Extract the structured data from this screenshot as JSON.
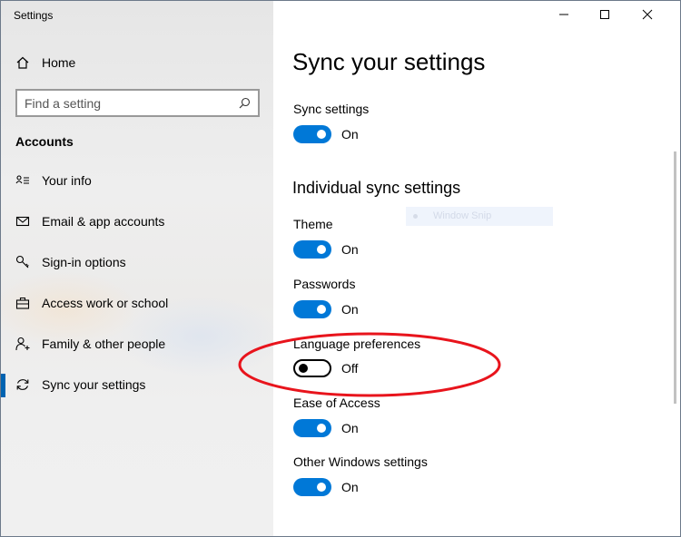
{
  "app": {
    "title": "Settings"
  },
  "sidebar": {
    "home_label": "Home",
    "search": {
      "placeholder": "Find a setting",
      "value": ""
    },
    "section_title": "Accounts",
    "items": [
      {
        "label": "Your info",
        "icon": "contact-card-icon",
        "selected": false
      },
      {
        "label": "Email & app accounts",
        "icon": "mail-icon",
        "selected": false
      },
      {
        "label": "Sign-in options",
        "icon": "key-icon",
        "selected": false
      },
      {
        "label": "Access work or school",
        "icon": "briefcase-icon",
        "selected": false
      },
      {
        "label": "Family & other people",
        "icon": "person-add-icon",
        "selected": false
      },
      {
        "label": "Sync your settings",
        "icon": "sync-icon",
        "selected": true
      }
    ]
  },
  "main": {
    "title": "Sync your settings",
    "sync_settings": {
      "label": "Sync settings",
      "state": "On"
    },
    "individual_title": "Individual sync settings",
    "settings": [
      {
        "label": "Theme",
        "state": "On"
      },
      {
        "label": "Passwords",
        "state": "On"
      },
      {
        "label": "Language preferences",
        "state": "Off"
      },
      {
        "label": "Ease of Access",
        "state": "On"
      },
      {
        "label": "Other Windows settings",
        "state": "On"
      }
    ]
  },
  "overlay": {
    "snip_text": "Window Snip"
  },
  "colors": {
    "accent": "#0078d7",
    "annotation": "#e8141c",
    "selection": "#0063b1"
  }
}
